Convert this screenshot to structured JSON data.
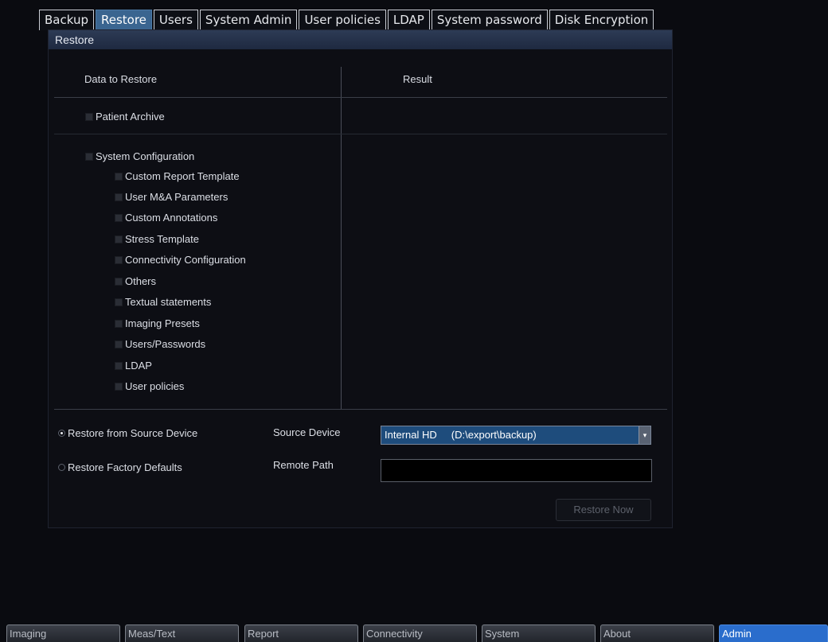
{
  "tabs": [
    "Backup",
    "Restore",
    "Users",
    "System Admin",
    "User policies",
    "LDAP",
    "System password",
    "Disk Encryption"
  ],
  "active_tab": "Restore",
  "panel": {
    "title": "Restore",
    "col_data": "Data to Restore",
    "col_result": "Result"
  },
  "items": {
    "patient_archive": "Patient Archive",
    "system_configuration": "System Configuration",
    "sub": [
      "Custom Report Template",
      "User M&A Parameters",
      "Custom Annotations",
      "Stress Template",
      "Connectivity Configuration",
      "Others",
      "Textual statements",
      "Imaging Presets",
      "Users/Passwords",
      "LDAP",
      "User policies"
    ]
  },
  "restore": {
    "from_source": "Restore from Source Device",
    "factory": "Restore Factory Defaults",
    "source_device_label": "Source Device",
    "source_device_value": "Internal HD     (D:\\export\\backup)",
    "remote_path_label": "Remote Path",
    "remote_path_value": "",
    "restore_now": "Restore Now"
  },
  "bottom_tabs": [
    "Imaging",
    "Meas/Text",
    "Report",
    "Connectivity",
    "System",
    "About",
    "Admin"
  ],
  "active_bottom_tab": "Admin"
}
